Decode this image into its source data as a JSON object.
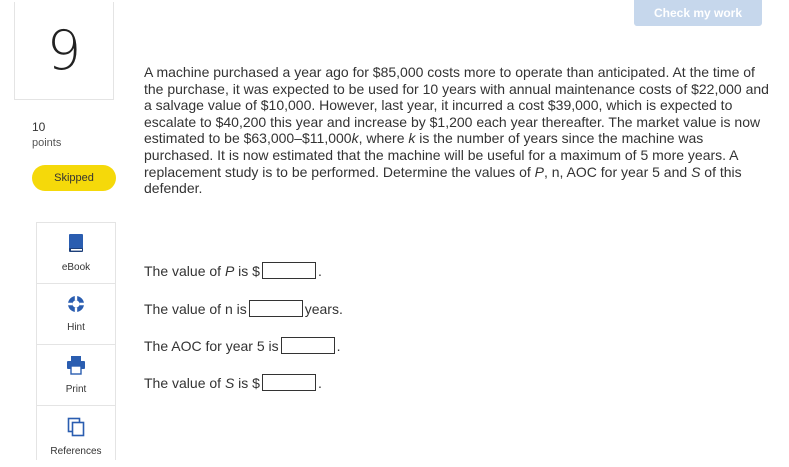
{
  "question_number": "9",
  "points": {
    "value": "10",
    "label": "points"
  },
  "status_badge": "Skipped",
  "check_button": "Check my work",
  "tools": [
    {
      "label": "eBook",
      "icon": "book-icon"
    },
    {
      "label": "Hint",
      "icon": "lifebuoy-icon"
    },
    {
      "label": "Print",
      "icon": "printer-icon"
    },
    {
      "label": "References",
      "icon": "documents-icon"
    }
  ],
  "question": {
    "part1": "A machine purchased a year ago for $85,000 costs more to operate than anticipated. At the time of the purchase, it was expected to be used for 10 years with annual maintenance costs of $22,000 and a salvage value of $10,000. However, last year, it incurred a cost $39,000, which is expected to escalate to $40,200 this year and increase by $1,200 each year thereafter. The market value is now estimated to be $63,000–$11,000",
    "k1": "k",
    "part2": ", where ",
    "k2": "k",
    "part3": " is the number of years since the machine was purchased. It is now estimated that the machine will be useful for a maximum of 5 more years. A replacement study is to be performed. Determine the values of ",
    "P": "P",
    "part4": ", n, AOC for year 5 and ",
    "S": "S",
    "part5": " of this defender."
  },
  "answers": [
    {
      "pre": "The value of ",
      "var": "P",
      "mid": " is $",
      "post": "."
    },
    {
      "pre": "The value of n is",
      "var": "",
      "mid": "",
      "post": "years."
    },
    {
      "pre": "The AOC for year 5 is",
      "var": "",
      "mid": "",
      "post": "."
    },
    {
      "pre": "The value of ",
      "var": "S",
      "mid": " is $",
      "post": "."
    }
  ]
}
